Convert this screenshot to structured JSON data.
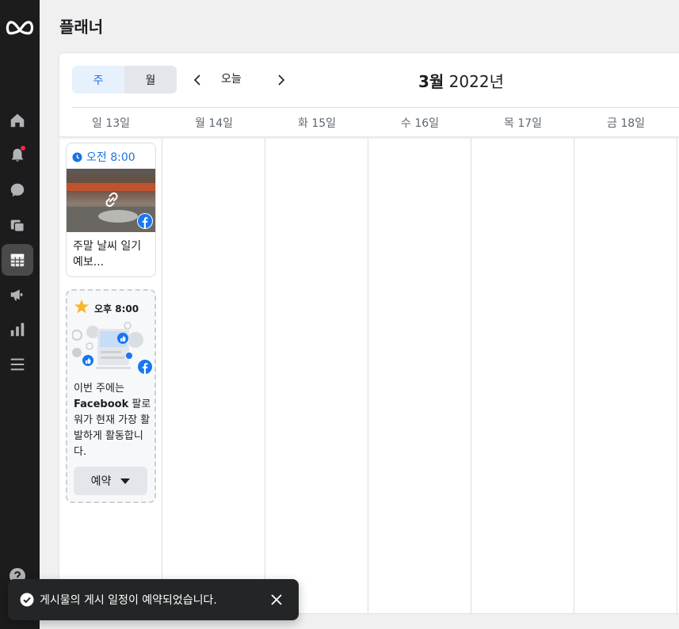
{
  "header": {
    "title": "플래너"
  },
  "sidebar": {
    "items": [
      {
        "icon": "home-icon"
      },
      {
        "icon": "bell-icon"
      },
      {
        "icon": "chat-icon"
      },
      {
        "icon": "pages-icon"
      },
      {
        "icon": "calendar-grid-icon"
      },
      {
        "icon": "megaphone-icon"
      },
      {
        "icon": "bar-chart-icon"
      },
      {
        "icon": "menu-icon"
      }
    ],
    "bottom": {
      "icon": "help-icon"
    }
  },
  "toolbar": {
    "week_label": "주",
    "month_label": "월",
    "today_label": "오늘",
    "month_bold": "3월",
    "year_text": " 2022년"
  },
  "days": [
    {
      "label": "일 13일"
    },
    {
      "label": "월 14일"
    },
    {
      "label": "화 15일"
    },
    {
      "label": "수 16일"
    },
    {
      "label": "목 17일"
    },
    {
      "label": "금 18일"
    }
  ],
  "post": {
    "time": "오전 8:00",
    "text": "주말 날씨 일기 예보..."
  },
  "recommendation": {
    "time": "오후 8:00",
    "text_before": "이번 주에는 ",
    "text_bold": "Facebook",
    "text_after": " 팔로워가 현재 가장 활발하게 활동합니다.",
    "button_label": "예약"
  },
  "toast": {
    "message": "게시물의 게시 일정이 예약되었습니다."
  },
  "colors": {
    "accent": "#1b74e4",
    "sidebar_bg": "#1c1c1c",
    "toast_bg": "#242526",
    "facebook": "#1877f2"
  }
}
